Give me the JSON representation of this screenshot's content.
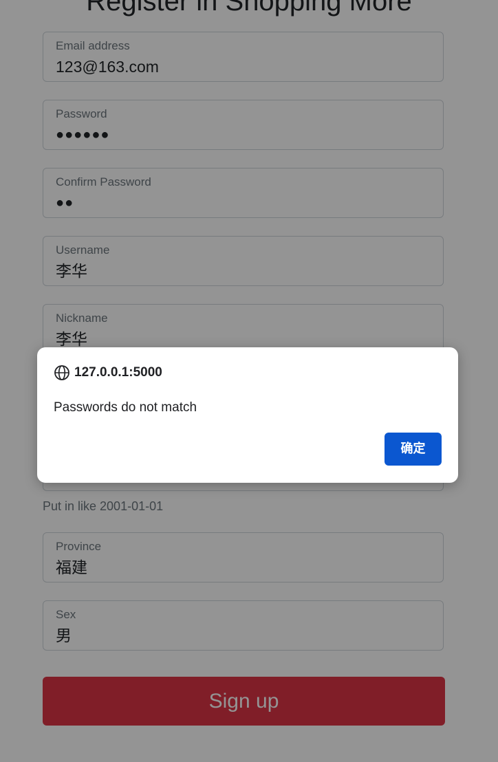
{
  "page": {
    "title": "Register in Shopping More"
  },
  "form": {
    "email": {
      "label": "Email address",
      "value": "123@163.com"
    },
    "password": {
      "label": "Password",
      "value": "●●●●●●"
    },
    "confirm_password": {
      "label": "Confirm Password",
      "value": "●●"
    },
    "username": {
      "label": "Username",
      "value": "李华"
    },
    "nickname": {
      "label": "Nickname",
      "value": "李华"
    },
    "birthday_hint": "Put in like 2001-01-01",
    "province": {
      "label": "Province",
      "value": "福建"
    },
    "sex": {
      "label": "Sex",
      "value": "男"
    },
    "submit_label": "Sign up"
  },
  "dialog": {
    "origin": "127.0.0.1:5000",
    "message": "Passwords do not match",
    "ok_label": "确定",
    "icon": "globe-icon"
  },
  "colors": {
    "signup_button": "#dc3545",
    "dialog_ok_button": "#0b57d0"
  }
}
